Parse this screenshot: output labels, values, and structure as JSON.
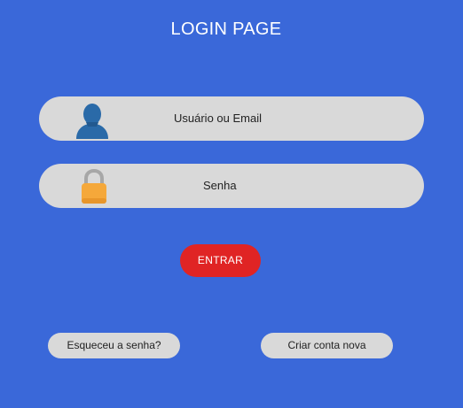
{
  "header": {
    "title": "LOGIN PAGE"
  },
  "form": {
    "username": {
      "label": "Usuário ou Email",
      "icon": "user-icon"
    },
    "password": {
      "label": "Senha",
      "icon": "lock-icon"
    },
    "submit_label": "ENTRAR"
  },
  "links": {
    "forgot_password": "Esqueceu a senha?",
    "create_account": "Criar conta nova"
  },
  "colors": {
    "background": "#3a68d9",
    "field": "#d9d9d9",
    "submit": "#e02424",
    "user_icon": "#2a6aa8",
    "lock_body": "#f5a83a"
  }
}
